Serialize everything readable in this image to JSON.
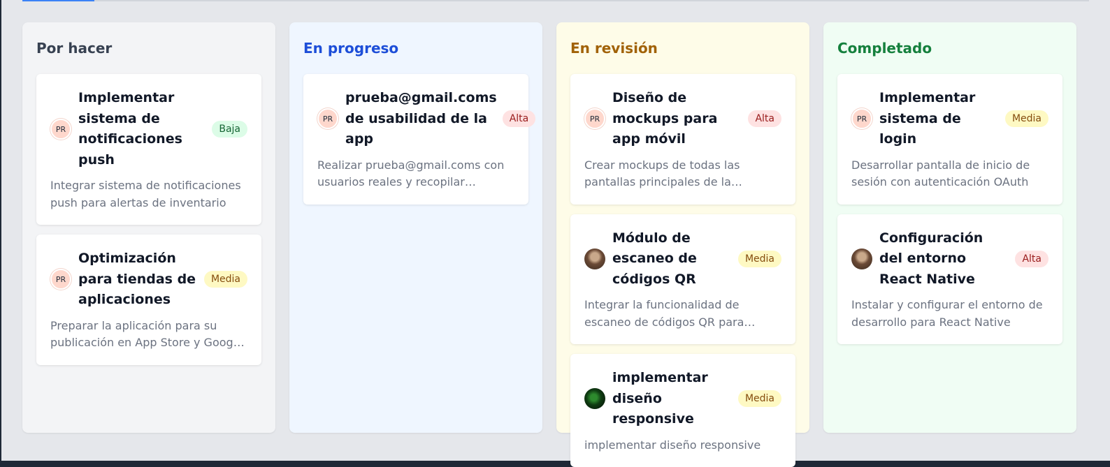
{
  "columns": [
    {
      "title": "Por hacer",
      "bg": "#f3f4f6",
      "color": "#374151",
      "cards": [
        {
          "title": "Implementar sistema de notificaciones push",
          "priority": "Baja",
          "avatar": "PR",
          "description": "Integrar sistema de notificaciones push para alertas de inventario"
        },
        {
          "title": "Optimización para tiendas de aplicaciones",
          "priority": "Media",
          "avatar": "PR",
          "description": "Preparar la aplicación para su publicación en App Store y Google Play"
        }
      ]
    },
    {
      "title": "En progreso",
      "bg": "#eff6ff",
      "color": "#1d4ed8",
      "cards": [
        {
          "title": "prueba@gmail.coms de usabilidad de la app",
          "priority": "Alta",
          "avatar": "PR",
          "description": "Realizar prueba@gmail.coms con usuarios reales y recopilar feedback"
        }
      ]
    },
    {
      "title": "En revisión",
      "bg": "#fefce8",
      "color": "#a16207",
      "cards": [
        {
          "title": "Diseño de mockups para app móvil",
          "priority": "Alta",
          "avatar": "PR",
          "description": "Crear mockups de todas las pantallas principales de la aplicación"
        },
        {
          "title": "Módulo de escaneo de códigos QR",
          "priority": "Media",
          "avatar": "photo-brown",
          "description": "Integrar la funcionalidad de escaneo de códigos QR para productos"
        },
        {
          "title": "implementar diseño responsive",
          "priority": "Media",
          "avatar": "photo-dark",
          "description": "implementar diseño responsive"
        }
      ]
    },
    {
      "title": "Completado",
      "bg": "#f0fdf4",
      "color": "#15803d",
      "cards": [
        {
          "title": "Implementar sistema de login",
          "priority": "Media",
          "avatar": "PR",
          "description": "Desarrollar pantalla de inicio de sesión con autenticación OAuth"
        },
        {
          "title": "Configuración del entorno React Native",
          "priority": "Alta",
          "avatar": "photo-brown",
          "description": "Instalar y configurar el entorno de desarrollo para React Native"
        }
      ]
    }
  ]
}
